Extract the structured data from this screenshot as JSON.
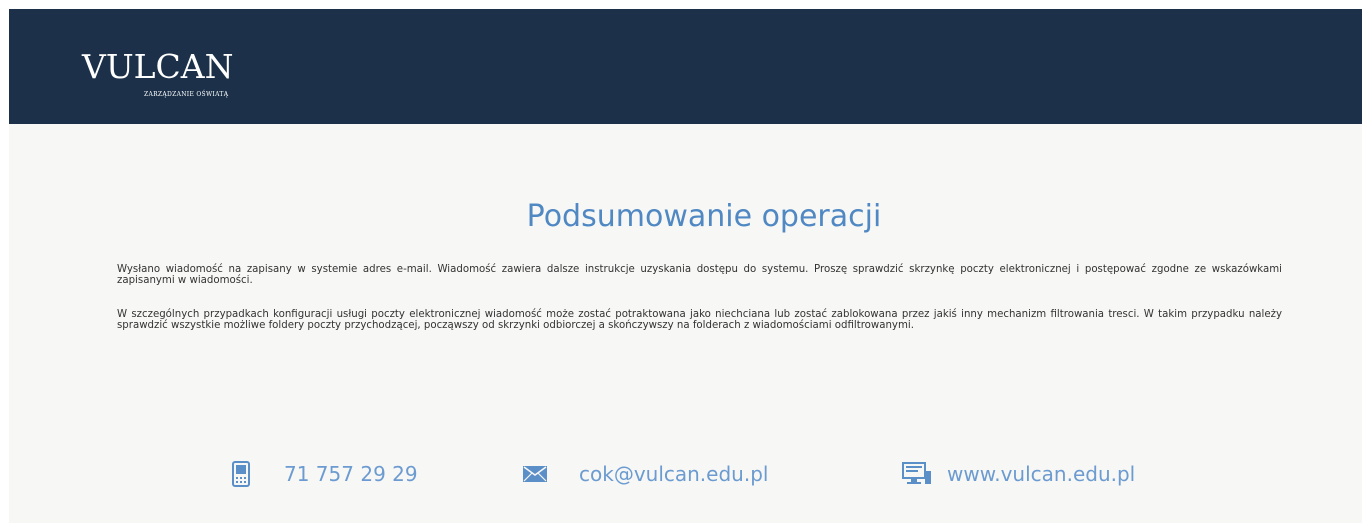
{
  "header": {
    "logo_text": "VULCAN",
    "logo_tagline": "ZARZĄDZANIE OŚWIATĄ",
    "background_color": "#1c3149"
  },
  "main": {
    "title": "Podsumowanie operacji",
    "paragraphs": [
      "Wysłano wiadomość na zapisany w systemie adres e-mail. Wiadomość zawiera dalsze instrukcje uzyskania dostępu do systemu. Proszę sprawdzić skrzynkę poczty elektronicznej i postępować zgodne ze wskazówkami zapisanymi w wiadomości.",
      "W szczególnych przypadkach konfiguracji usługi poczty elektronicznej wiadomość może zostać potraktowana jako niechciana lub zostać zablokowana przez jakiś inny mechanizm filtrowania tresci. W takim przypadku należy sprawdzić wszystkie możliwe foldery poczty przychodzącej, począwszy od skrzynki odbiorczej a skończywszy na folderach z wiadomościami odfiltrowanymi."
    ]
  },
  "contacts": {
    "phone": {
      "icon": "phone-icon",
      "label": "71 757 29 29"
    },
    "email": {
      "icon": "envelope-icon",
      "label": "cok@vulcan.edu.pl"
    },
    "website": {
      "icon": "computer-monitor-icon",
      "label": "www.vulcan.edu.pl"
    },
    "accent_color": "#4f88c3"
  }
}
